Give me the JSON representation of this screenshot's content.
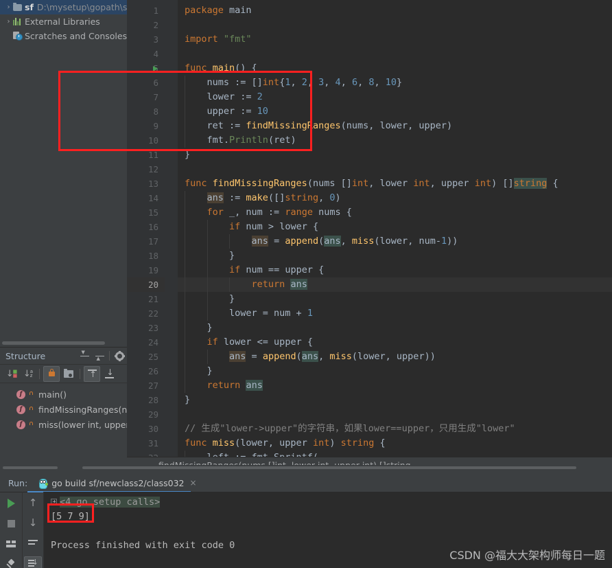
{
  "project_tree": {
    "items": [
      {
        "label_name": "sf",
        "label_path": "D:\\mysetup\\gopath\\s",
        "icon": "folder-icon",
        "arrow": "›",
        "selected": true
      },
      {
        "label_name": "",
        "label_path": "External Libraries",
        "icon": "libraries-icon",
        "arrow": "›",
        "selected": false
      },
      {
        "label_name": "",
        "label_path": "Scratches and Consoles",
        "icon": "scratches-icon",
        "arrow": "",
        "selected": false
      }
    ]
  },
  "structure": {
    "title": "Structure",
    "header_icons": [
      "expand-all-icon",
      "collapse-all-icon",
      "settings-gear-icon"
    ],
    "toolbar_icons": [
      "sort-by-visibility-icon",
      "sort-alphabetically-icon",
      "show-non-public-icon",
      "group-by-file-icon",
      "show-inherited-icon",
      "show-anonymous-icon"
    ],
    "items": [
      {
        "label": "main()",
        "icon": "function-icon",
        "visibility": "public-lock-icon"
      },
      {
        "label": "findMissingRanges(n",
        "icon": "function-icon",
        "visibility": "public-lock-icon"
      },
      {
        "label": "miss(lower int, upper",
        "icon": "function-icon",
        "visibility": "public-lock-icon"
      }
    ]
  },
  "editor": {
    "current_line": 20,
    "run_marker_line": 5,
    "lines": [
      {
        "n": 1,
        "tokens": [
          {
            "t": "package ",
            "c": "kw"
          },
          {
            "t": "main",
            "c": "ident"
          }
        ],
        "indent": 0
      },
      {
        "n": 2,
        "tokens": [],
        "indent": 0
      },
      {
        "n": 3,
        "tokens": [
          {
            "t": "import ",
            "c": "kw"
          },
          {
            "t": "\"fmt\"",
            "c": "str"
          }
        ],
        "indent": 0
      },
      {
        "n": 4,
        "tokens": [],
        "indent": 0
      },
      {
        "n": 5,
        "tokens": [
          {
            "t": "func ",
            "c": "kw"
          },
          {
            "t": "main",
            "c": "fn"
          },
          {
            "t": "() {",
            "c": "ident"
          }
        ],
        "indent": 0
      },
      {
        "n": 6,
        "tokens": [
          {
            "t": "    nums := []",
            "c": "ident"
          },
          {
            "t": "int",
            "c": "typ"
          },
          {
            "t": "{",
            "c": "ident"
          },
          {
            "t": "1",
            "c": "num"
          },
          {
            "t": ", ",
            "c": "ident"
          },
          {
            "t": "2",
            "c": "num"
          },
          {
            "t": ", ",
            "c": "ident"
          },
          {
            "t": "3",
            "c": "num"
          },
          {
            "t": ", ",
            "c": "ident"
          },
          {
            "t": "4",
            "c": "num"
          },
          {
            "t": ", ",
            "c": "ident"
          },
          {
            "t": "6",
            "c": "num"
          },
          {
            "t": ", ",
            "c": "ident"
          },
          {
            "t": "8",
            "c": "num"
          },
          {
            "t": ", ",
            "c": "ident"
          },
          {
            "t": "10",
            "c": "num"
          },
          {
            "t": "}",
            "c": "ident"
          }
        ],
        "indent": 1
      },
      {
        "n": 7,
        "tokens": [
          {
            "t": "    lower := ",
            "c": "ident"
          },
          {
            "t": "2",
            "c": "num"
          }
        ],
        "indent": 1
      },
      {
        "n": 8,
        "tokens": [
          {
            "t": "    upper := ",
            "c": "ident"
          },
          {
            "t": "10",
            "c": "num"
          }
        ],
        "indent": 1
      },
      {
        "n": 9,
        "tokens": [
          {
            "t": "    ret := ",
            "c": "ident"
          },
          {
            "t": "findMissingRanges",
            "c": "fn"
          },
          {
            "t": "(nums, lower, upper)",
            "c": "ident"
          }
        ],
        "indent": 1
      },
      {
        "n": 10,
        "tokens": [
          {
            "t": "    fmt.",
            "c": "ident"
          },
          {
            "t": "Println",
            "c": "str"
          },
          {
            "t": "(ret)",
            "c": "ident"
          }
        ],
        "indent": 1
      },
      {
        "n": 11,
        "tokens": [
          {
            "t": "}",
            "c": "ident"
          }
        ],
        "indent": 0
      },
      {
        "n": 12,
        "tokens": [],
        "indent": 0
      },
      {
        "n": 13,
        "tokens": [
          {
            "t": "func ",
            "c": "kw"
          },
          {
            "t": "findMissingRanges",
            "c": "fn"
          },
          {
            "t": "(nums []",
            "c": "ident"
          },
          {
            "t": "int",
            "c": "typ"
          },
          {
            "t": ", lower ",
            "c": "ident"
          },
          {
            "t": "int",
            "c": "typ"
          },
          {
            "t": ", upper ",
            "c": "ident"
          },
          {
            "t": "int",
            "c": "typ"
          },
          {
            "t": ") ",
            "c": "ident"
          },
          {
            "t": "[]",
            "c": "ident"
          },
          {
            "t": "string",
            "c": "hl-b-typ"
          },
          {
            "t": " {",
            "c": "ident"
          }
        ],
        "indent": 0
      },
      {
        "n": 14,
        "tokens": [
          {
            "t": "    ",
            "c": "ident"
          },
          {
            "t": "ans",
            "c": "hl-a"
          },
          {
            "t": " := ",
            "c": "ident"
          },
          {
            "t": "make",
            "c": "fn"
          },
          {
            "t": "([]",
            "c": "ident"
          },
          {
            "t": "string",
            "c": "typ"
          },
          {
            "t": ", ",
            "c": "ident"
          },
          {
            "t": "0",
            "c": "num"
          },
          {
            "t": ")",
            "c": "ident"
          }
        ],
        "indent": 1
      },
      {
        "n": 15,
        "tokens": [
          {
            "t": "    ",
            "c": "ident"
          },
          {
            "t": "for",
            "c": "kw"
          },
          {
            "t": " _, num := ",
            "c": "ident"
          },
          {
            "t": "range",
            "c": "kw"
          },
          {
            "t": " nums {",
            "c": "ident"
          }
        ],
        "indent": 1
      },
      {
        "n": 16,
        "tokens": [
          {
            "t": "        ",
            "c": "ident"
          },
          {
            "t": "if",
            "c": "kw"
          },
          {
            "t": " num > lower {",
            "c": "ident"
          }
        ],
        "indent": 2
      },
      {
        "n": 17,
        "tokens": [
          {
            "t": "            ",
            "c": "ident"
          },
          {
            "t": "ans",
            "c": "hl-a"
          },
          {
            "t": " = ",
            "c": "ident"
          },
          {
            "t": "append",
            "c": "fn"
          },
          {
            "t": "(",
            "c": "ident"
          },
          {
            "t": "ans",
            "c": "hl-b"
          },
          {
            "t": ", ",
            "c": "ident"
          },
          {
            "t": "miss",
            "c": "fn"
          },
          {
            "t": "(lower, num-",
            "c": "ident"
          },
          {
            "t": "1",
            "c": "num"
          },
          {
            "t": "))",
            "c": "ident"
          }
        ],
        "indent": 3
      },
      {
        "n": 18,
        "tokens": [
          {
            "t": "        }",
            "c": "ident"
          }
        ],
        "indent": 2
      },
      {
        "n": 19,
        "tokens": [
          {
            "t": "        ",
            "c": "ident"
          },
          {
            "t": "if",
            "c": "kw"
          },
          {
            "t": " num == upper {",
            "c": "ident"
          }
        ],
        "indent": 2
      },
      {
        "n": 20,
        "tokens": [
          {
            "t": "            ",
            "c": "ident"
          },
          {
            "t": "return",
            "c": "kw"
          },
          {
            "t": " ",
            "c": "ident"
          },
          {
            "t": "ans",
            "c": "hl-b"
          }
        ],
        "indent": 3
      },
      {
        "n": 21,
        "tokens": [
          {
            "t": "        }",
            "c": "ident"
          }
        ],
        "indent": 2
      },
      {
        "n": 22,
        "tokens": [
          {
            "t": "        lower = num + ",
            "c": "ident"
          },
          {
            "t": "1",
            "c": "num"
          }
        ],
        "indent": 2
      },
      {
        "n": 23,
        "tokens": [
          {
            "t": "    }",
            "c": "ident"
          }
        ],
        "indent": 1
      },
      {
        "n": 24,
        "tokens": [
          {
            "t": "    ",
            "c": "ident"
          },
          {
            "t": "if",
            "c": "kw"
          },
          {
            "t": " lower <= upper {",
            "c": "ident"
          }
        ],
        "indent": 1
      },
      {
        "n": 25,
        "tokens": [
          {
            "t": "        ",
            "c": "ident"
          },
          {
            "t": "ans",
            "c": "hl-a"
          },
          {
            "t": " = ",
            "c": "ident"
          },
          {
            "t": "append",
            "c": "fn"
          },
          {
            "t": "(",
            "c": "ident"
          },
          {
            "t": "ans",
            "c": "hl-b"
          },
          {
            "t": ", ",
            "c": "ident"
          },
          {
            "t": "miss",
            "c": "fn"
          },
          {
            "t": "(lower, upper))",
            "c": "ident"
          }
        ],
        "indent": 2
      },
      {
        "n": 26,
        "tokens": [
          {
            "t": "    }",
            "c": "ident"
          }
        ],
        "indent": 1
      },
      {
        "n": 27,
        "tokens": [
          {
            "t": "    ",
            "c": "ident"
          },
          {
            "t": "return",
            "c": "kw"
          },
          {
            "t": " ",
            "c": "ident"
          },
          {
            "t": "ans",
            "c": "hl-b"
          }
        ],
        "indent": 1
      },
      {
        "n": 28,
        "tokens": [
          {
            "t": "}",
            "c": "ident"
          }
        ],
        "indent": 0
      },
      {
        "n": 29,
        "tokens": [],
        "indent": 0
      },
      {
        "n": 30,
        "tokens": [
          {
            "t": "// 生成\"lower->upper\"的字符串，如果lower==upper，只用生成\"lower\"",
            "c": "cmt"
          }
        ],
        "indent": 0
      },
      {
        "n": 31,
        "tokens": [
          {
            "t": "func ",
            "c": "kw"
          },
          {
            "t": "miss",
            "c": "fn"
          },
          {
            "t": "(lower, upper ",
            "c": "ident"
          },
          {
            "t": "int",
            "c": "typ"
          },
          {
            "t": ") ",
            "c": "ident"
          },
          {
            "t": "string",
            "c": "typ"
          },
          {
            "t": " {",
            "c": "ident"
          }
        ],
        "indent": 0
      },
      {
        "n": 32,
        "tokens": [
          {
            "t": "    left := fmt.Sprintf(",
            "c": "ident"
          }
        ],
        "indent": 1
      }
    ]
  },
  "breadcrumb": {
    "text": "findMissingRanges(nums []int, lower int, upper int) []string"
  },
  "run_panel": {
    "run_label": "Run:",
    "tab_label": "go build sf/newclass2/class032",
    "tab_close": "×",
    "toolbar_left_icons": [
      "rerun-play-icon",
      "stop-icon",
      "layout-icon",
      "pin-tab-icon"
    ],
    "toolbar_mid_icons": [
      "up-arrow-icon",
      "down-arrow-icon",
      "soft-wrap-icon",
      "scroll-to-end-icon"
    ],
    "console": {
      "collapsed_frames": "<4 go setup calls>",
      "output": "[5 7 9]",
      "blank": "",
      "exit": "Process finished with exit code 0"
    }
  },
  "annotations": {
    "box_color": "#ff2020",
    "code_box_target": "main-function-body",
    "console_box_target": "program-output"
  },
  "watermark": {
    "text": "CSDN @福大大架构师每日一题"
  },
  "theme": {
    "accent": "#4a88c7",
    "panel_bg": "#3c3f41",
    "editor_bg": "#2b2b2b",
    "gutter_bg": "#313335",
    "selection_bg": "#2b4564",
    "keyword": "#cc7832",
    "function": "#ffc66d",
    "string": "#6a8759",
    "number": "#6897bb",
    "comment": "#808080",
    "default_text": "#a9b7c6"
  }
}
